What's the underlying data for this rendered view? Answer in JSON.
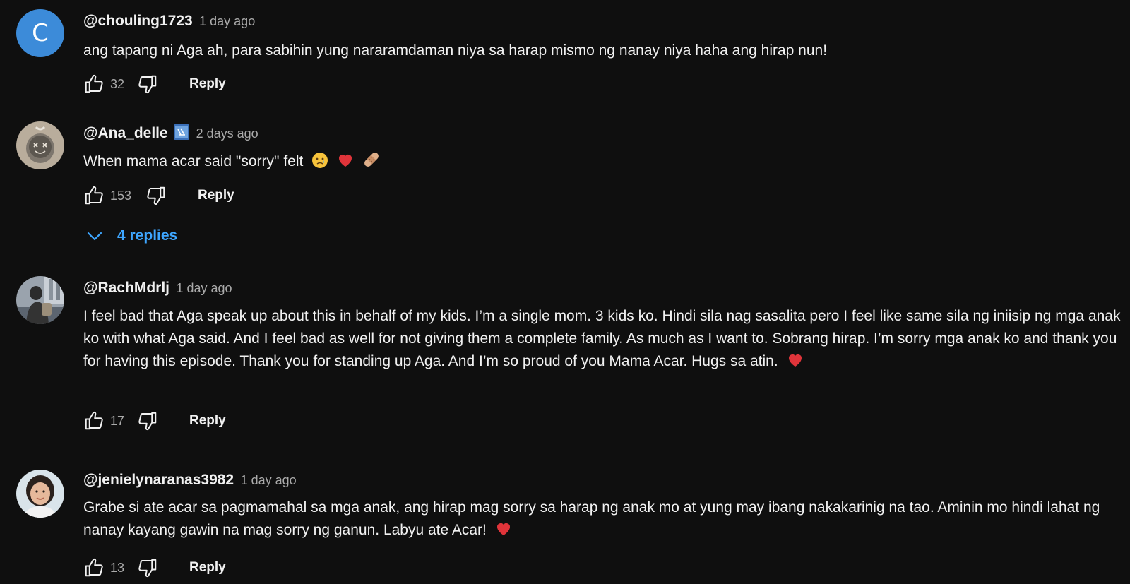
{
  "colors": {
    "background": "#0f0f0f",
    "text_primary": "#f1f1f1",
    "text_secondary": "#aaaaaa",
    "link_blue": "#3ea6ff",
    "avatar_c_bg": "#3c8bd9",
    "heart": "#e0343a"
  },
  "comments": [
    {
      "avatar_letter": "C",
      "author": "@chouling1723",
      "time": "1 day ago",
      "text": "ang tapang ni Aga ah, para sabihin yung nararamdaman niya sa harap mismo ng nanay niya haha ang hirap nun!",
      "likes": "32",
      "reply_label": "Reply"
    },
    {
      "author": "@Ana_delle",
      "time": "2 days ago",
      "text": "When mama acar said \"sorry\" felt",
      "emojis": [
        "crying-face-icon",
        "red-heart-icon",
        "bandage-icon"
      ],
      "likes": "153",
      "reply_label": "Reply",
      "replies_label": "4 replies"
    },
    {
      "author": "@RachMdrlj",
      "time": "1 day ago",
      "text": "I feel bad that Aga speak up about this in behalf of my kids. I’m a single mom. 3 kids ko. Hindi sila nag sasalita pero I feel like same sila ng iniisip ng mga anak ko with what Aga said. And I feel bad as well for not giving them a complete family. As much as I want to. Sobrang hirap. I’m sorry mga anak ko and thank you for having this episode. Thank you for standing up Aga. And I’m so proud of you Mama Acar. Hugs sa atin.",
      "emojis": [
        "red-heart-icon"
      ],
      "likes": "17",
      "reply_label": "Reply"
    },
    {
      "author": "@jenielynaranas3982",
      "time": "1 day ago",
      "text": "Grabe si ate acar sa pagmamahal sa mga anak, ang hirap mag sorry sa harap ng anak mo at yung may ibang nakakarinig na tao. Aminin mo hindi lahat ng nanay kayang gawin na mag sorry ng ganun. Labyu ate Acar!",
      "emojis": [
        "red-heart-icon"
      ],
      "likes": "13",
      "reply_label": "Reply"
    }
  ]
}
